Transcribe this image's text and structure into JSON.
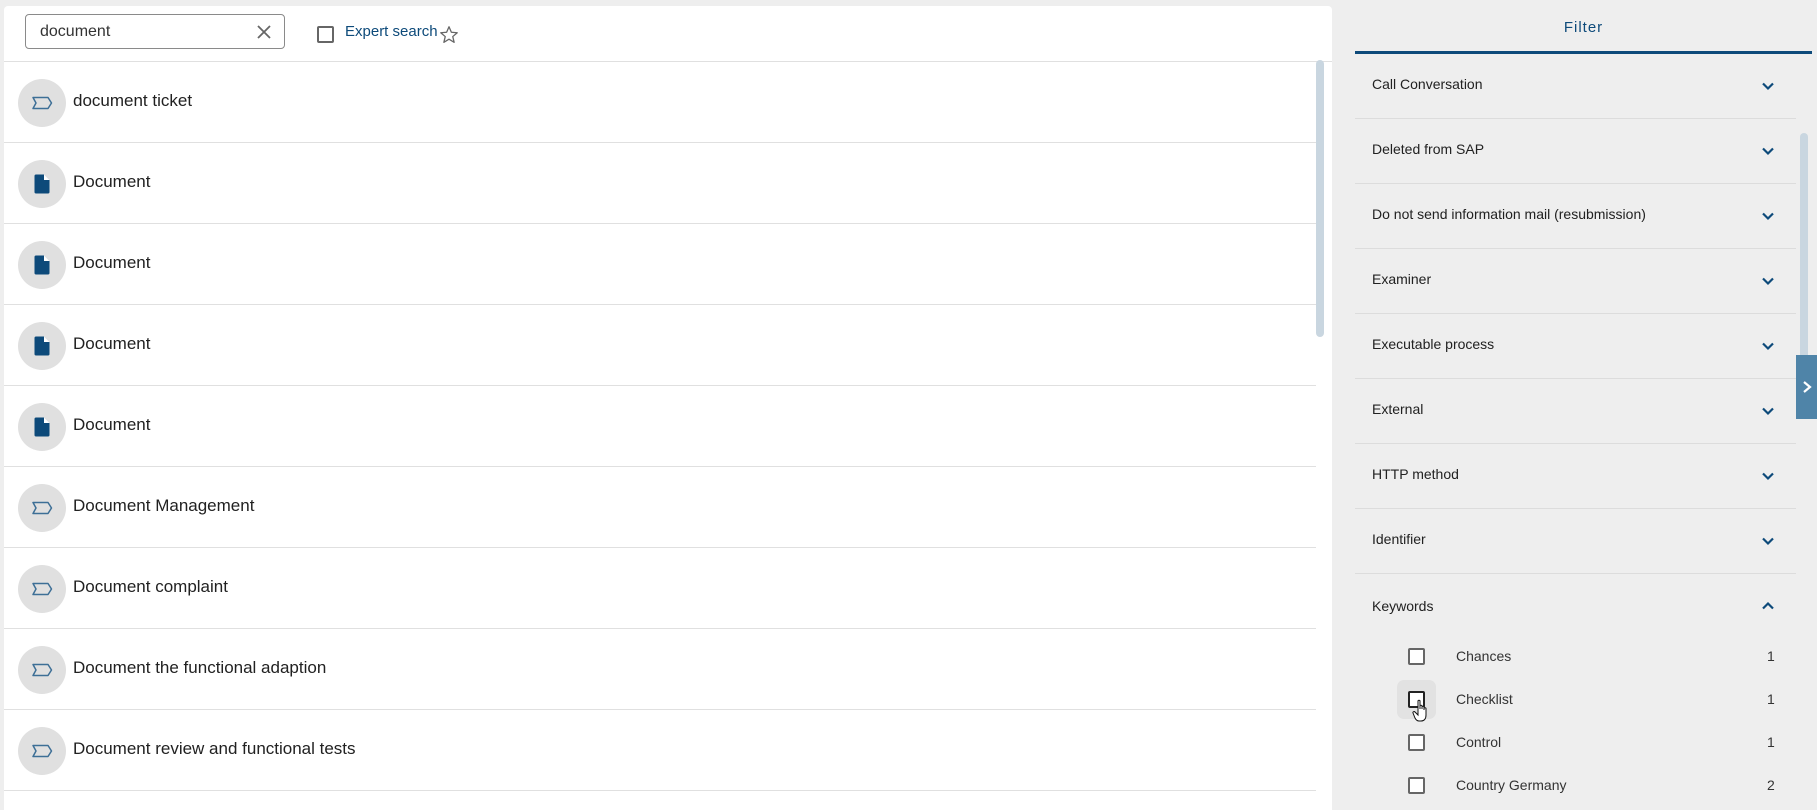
{
  "search": {
    "value": "document",
    "clear_icon": "close-icon",
    "expert_search_label": "Expert search",
    "expert_search_checked": false,
    "favorite_icon": "star-outline-icon"
  },
  "results": [
    {
      "title": "document ticket",
      "icon": "ticket-tag-icon"
    },
    {
      "title": "Document",
      "icon": "document-file-icon"
    },
    {
      "title": "Document",
      "icon": "document-file-icon"
    },
    {
      "title": "Document",
      "icon": "document-file-icon"
    },
    {
      "title": "Document",
      "icon": "document-file-icon"
    },
    {
      "title": "Document Management",
      "icon": "ticket-tag-icon"
    },
    {
      "title": "Document complaint",
      "icon": "ticket-tag-icon"
    },
    {
      "title": "Document the functional adaption",
      "icon": "ticket-tag-icon"
    },
    {
      "title": "Document review and functional tests",
      "icon": "ticket-tag-icon"
    }
  ],
  "filter": {
    "tab_label": "Filter",
    "sections": [
      {
        "label": "Call Conversation",
        "expanded": false
      },
      {
        "label": "Deleted from SAP",
        "expanded": false
      },
      {
        "label": "Do not send information mail (resubmission)",
        "expanded": false
      },
      {
        "label": "Examiner",
        "expanded": false
      },
      {
        "label": "Executable process",
        "expanded": false
      },
      {
        "label": "External",
        "expanded": false
      },
      {
        "label": "HTTP method",
        "expanded": false
      },
      {
        "label": "Identifier",
        "expanded": false
      }
    ],
    "keywords": {
      "label": "Keywords",
      "expanded": true,
      "items": [
        {
          "label": "Chances",
          "count": "1",
          "checked": false
        },
        {
          "label": "Checklist",
          "count": "1",
          "checked": false
        },
        {
          "label": "Control",
          "count": "1",
          "checked": false
        },
        {
          "label": "Country Germany",
          "count": "2",
          "checked": false
        }
      ]
    }
  },
  "colors": {
    "accent": "#0d4a7a",
    "panel_bg": "#eeeeee",
    "avatar_bg": "#e0e0e0",
    "collapse_tab": "#4f84a8"
  }
}
